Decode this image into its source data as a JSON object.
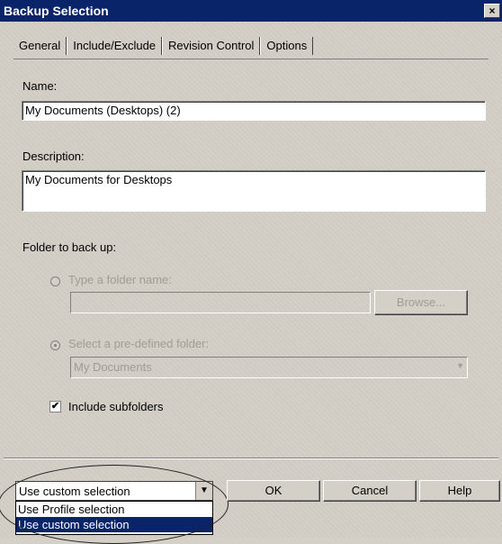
{
  "window": {
    "title": "Backup Selection",
    "close_glyph": "×"
  },
  "tabs": [
    "General",
    "Include/Exclude",
    "Revision Control",
    "Options"
  ],
  "general": {
    "name_label": "Name:",
    "name_value": "My Documents (Desktops) (2)",
    "description_label": "Description:",
    "description_value": "My Documents for Desktops",
    "folder_label": "Folder to back up:",
    "type_folder_label": "Type a folder name:",
    "type_folder_value": "",
    "browse_label": "Browse...",
    "predefined_label": "Select a pre-defined folder:",
    "predefined_value": "My Documents",
    "include_subfolders_label": "Include subfolders",
    "include_subfolders_checked": true
  },
  "bottom": {
    "selection_mode_value": "Use custom selection",
    "selection_mode_options": [
      "Use Profile selection",
      "Use custom selection"
    ],
    "ok_label": "OK",
    "cancel_label": "Cancel",
    "help_label": "Help"
  },
  "icons": {
    "check": "✔",
    "dropdown": "▼"
  },
  "colors": {
    "titlebar": "#0a246a",
    "dialog": "#d4d0c8",
    "highlight": "#0a246a"
  }
}
